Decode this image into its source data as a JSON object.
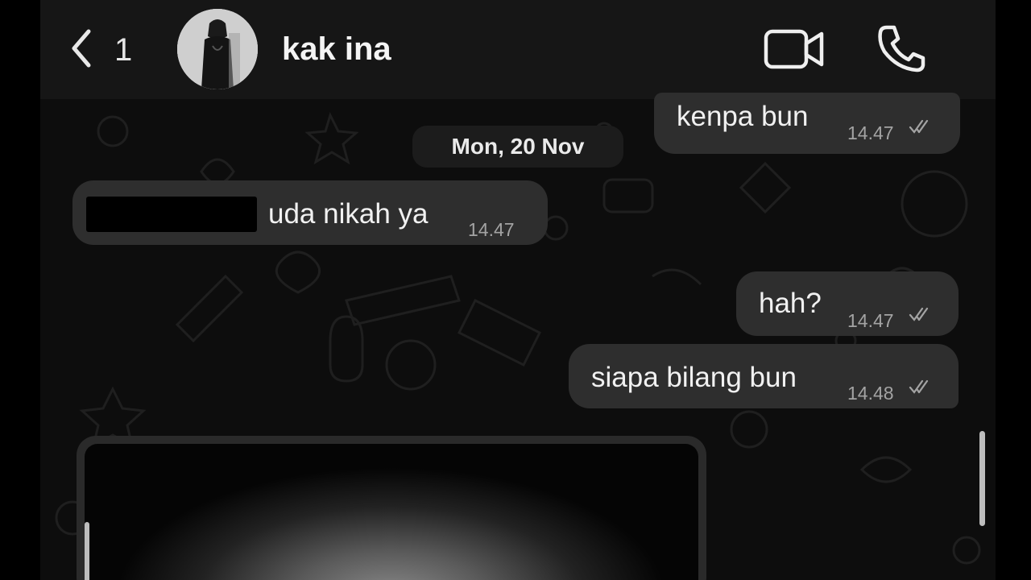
{
  "header": {
    "unread_count": "1",
    "contact_name": "kak ina"
  },
  "chat": {
    "date_separator": "Mon, 20 Nov",
    "messages": [
      {
        "direction": "outgoing",
        "text": "kenpa bun",
        "time": "14.47",
        "status": "read"
      },
      {
        "direction": "incoming",
        "text": "uda nikah ya",
        "time": "14.47",
        "redacted_prefix": true
      },
      {
        "direction": "outgoing",
        "text": "hah?",
        "time": "14.47",
        "status": "read"
      },
      {
        "direction": "outgoing",
        "text": "siapa bilang bun",
        "time": "14.48",
        "status": "read"
      },
      {
        "direction": "incoming",
        "type": "image"
      }
    ]
  },
  "icons": {
    "back": "chevron-left-icon",
    "video": "video-camera-icon",
    "call": "phone-icon",
    "read_receipt": "double-check-icon"
  },
  "colors": {
    "header_bg": "#161616",
    "bubble_bg": "#2e2e2e",
    "chat_bg": "#0d0d0d",
    "timestamp": "#a3a3a3"
  }
}
